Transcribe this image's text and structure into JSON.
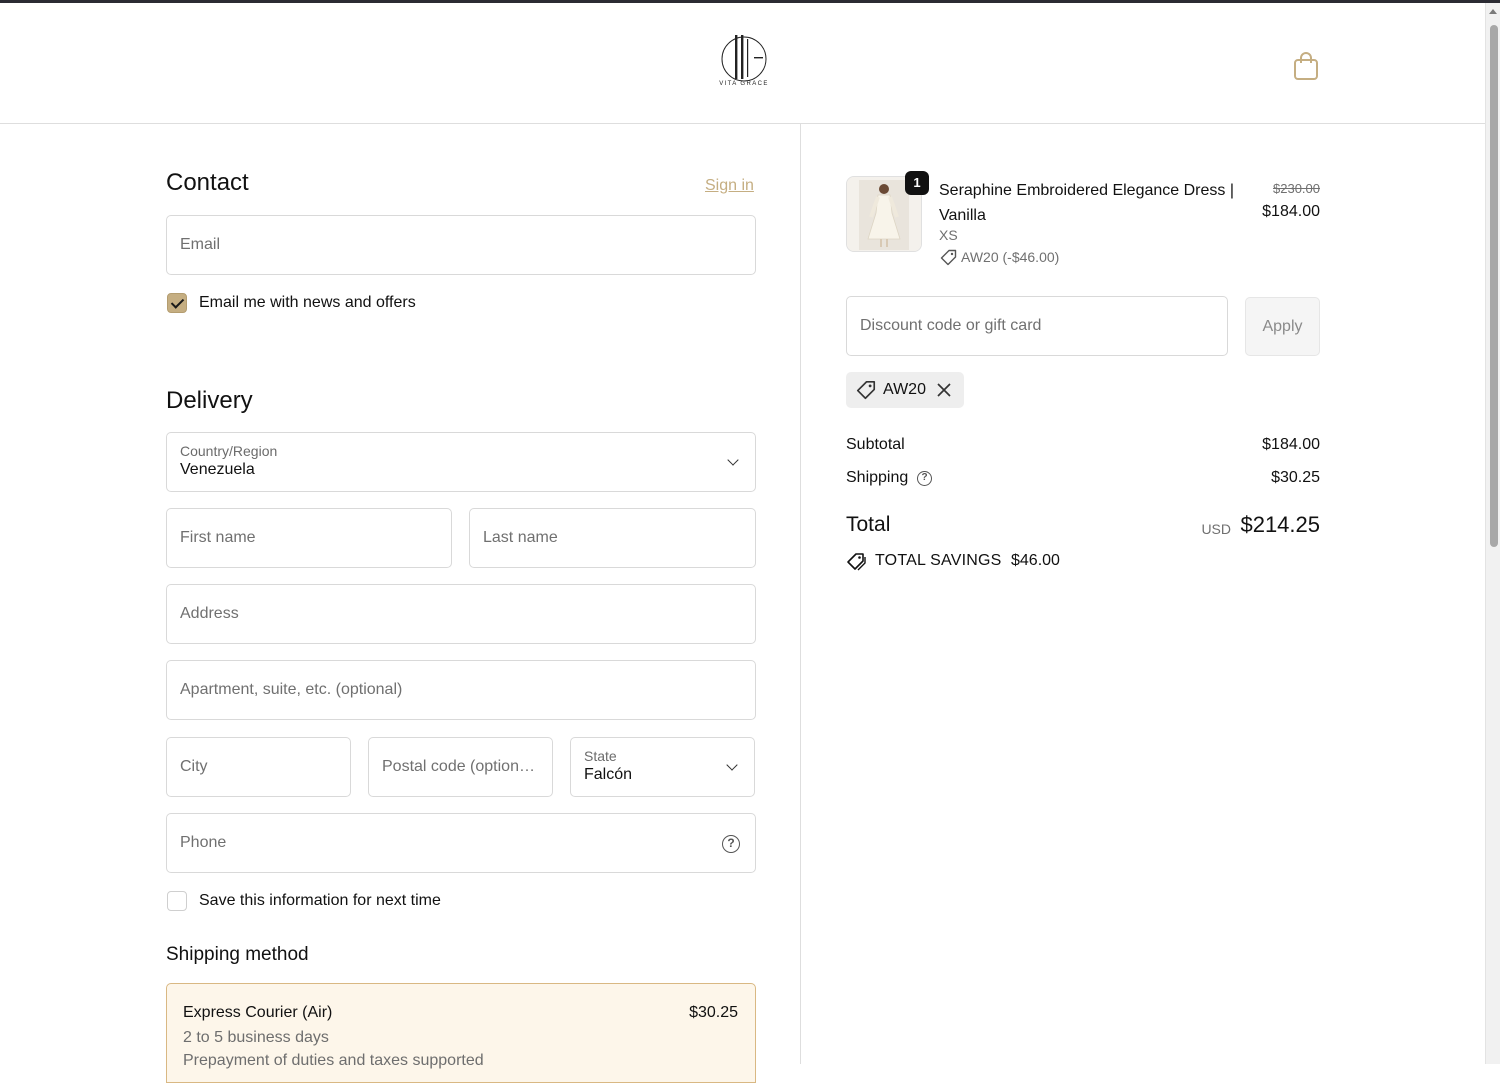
{
  "header": {
    "brand": "VITA GRACE",
    "cart_icon": "shopping-bag-icon"
  },
  "contact": {
    "title": "Contact",
    "sign_in": "Sign in",
    "email_placeholder": "Email",
    "newsletter_label": "Email me with news and offers",
    "newsletter_checked": true
  },
  "delivery": {
    "title": "Delivery",
    "country_label": "Country/Region",
    "country_value": "Venezuela",
    "first_name_placeholder": "First name",
    "last_name_placeholder": "Last name",
    "address_placeholder": "Address",
    "apartment_placeholder": "Apartment, suite, etc. (optional)",
    "city_placeholder": "City",
    "postal_placeholder": "Postal code (option…",
    "state_label": "State",
    "state_value": "Falcón",
    "phone_placeholder": "Phone",
    "save_info_label": "Save this information for next time",
    "save_info_checked": false
  },
  "shipping": {
    "title": "Shipping method",
    "option_name": "Express Courier (Air)",
    "option_price": "$30.25",
    "option_days": "2 to 5 business days",
    "option_note": "Prepayment of duties and taxes supported"
  },
  "summary": {
    "item": {
      "quantity": "1",
      "name": "Seraphine Embroidered Elegance Dress | Vanilla",
      "variant": "XS",
      "discount": "AW20 (-$46.00)",
      "original_price": "$230.00",
      "price": "$184.00"
    },
    "discount_placeholder": "Discount code or gift card",
    "apply_label": "Apply",
    "applied_code": "AW20",
    "subtotal_label": "Subtotal",
    "subtotal_value": "$184.00",
    "shipping_label": "Shipping",
    "shipping_value": "$30.25",
    "total_label": "Total",
    "currency": "USD",
    "total_value": "$214.25",
    "savings_label": "TOTAL SAVINGS",
    "savings_value": "$46.00"
  },
  "colors": {
    "accent": "#c5ae82",
    "shipping_bg": "#fdf6ea",
    "border": "#d9d9d9"
  }
}
